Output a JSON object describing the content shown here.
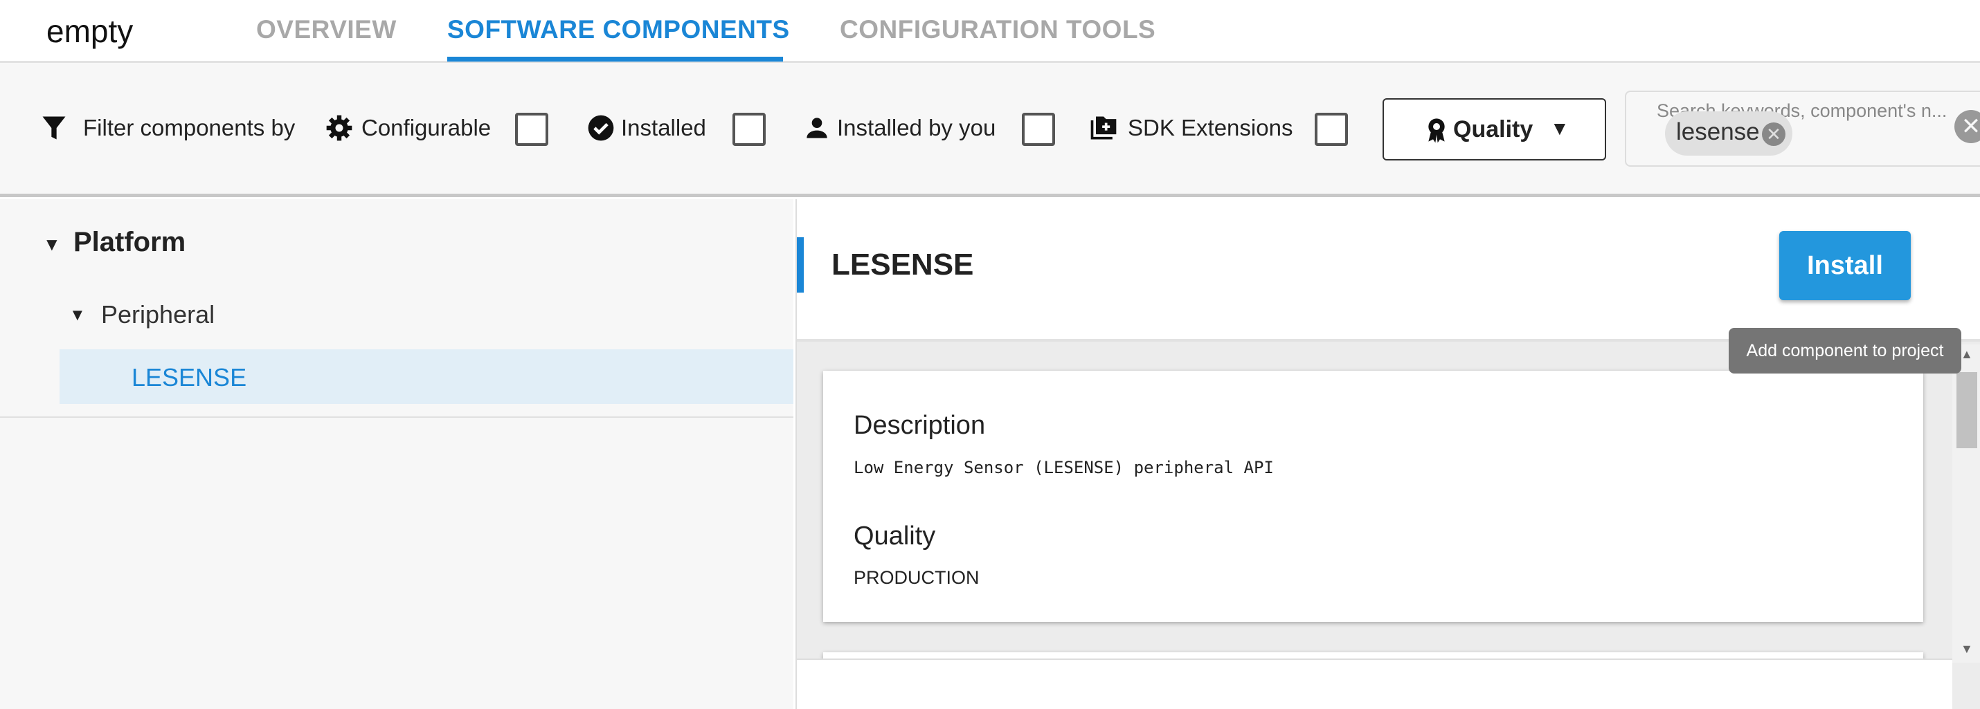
{
  "header": {
    "title": "empty",
    "tabs": [
      {
        "label": "OVERVIEW"
      },
      {
        "label": "SOFTWARE COMPONENTS",
        "active": true
      },
      {
        "label": "CONFIGURATION TOOLS"
      }
    ]
  },
  "filters": {
    "label": "Filter components by",
    "items": [
      {
        "label": "Configurable",
        "icon": "gear-icon",
        "checked": false
      },
      {
        "label": "Installed",
        "icon": "check-circle-icon",
        "checked": false
      },
      {
        "label": "Installed by you",
        "icon": "person-icon",
        "checked": false
      },
      {
        "label": "SDK Extensions",
        "icon": "folder-plus-icon",
        "checked": false
      }
    ],
    "quality_label": "Quality",
    "search_placeholder": "Search keywords, component's n...",
    "search_chip": "lesense"
  },
  "tree": {
    "root": "Platform",
    "child": "Peripheral",
    "leaf": "LESENSE"
  },
  "component": {
    "title": "LESENSE",
    "install_label": "Install",
    "tooltip": "Add component to project",
    "description_heading": "Description",
    "description": "Low Energy Sensor (LESENSE) peripheral API",
    "quality_heading": "Quality",
    "quality": "PRODUCTION"
  },
  "colors": {
    "accent": "#1a86d6",
    "install": "#2397dd",
    "selected_row": "#e1eef7"
  }
}
